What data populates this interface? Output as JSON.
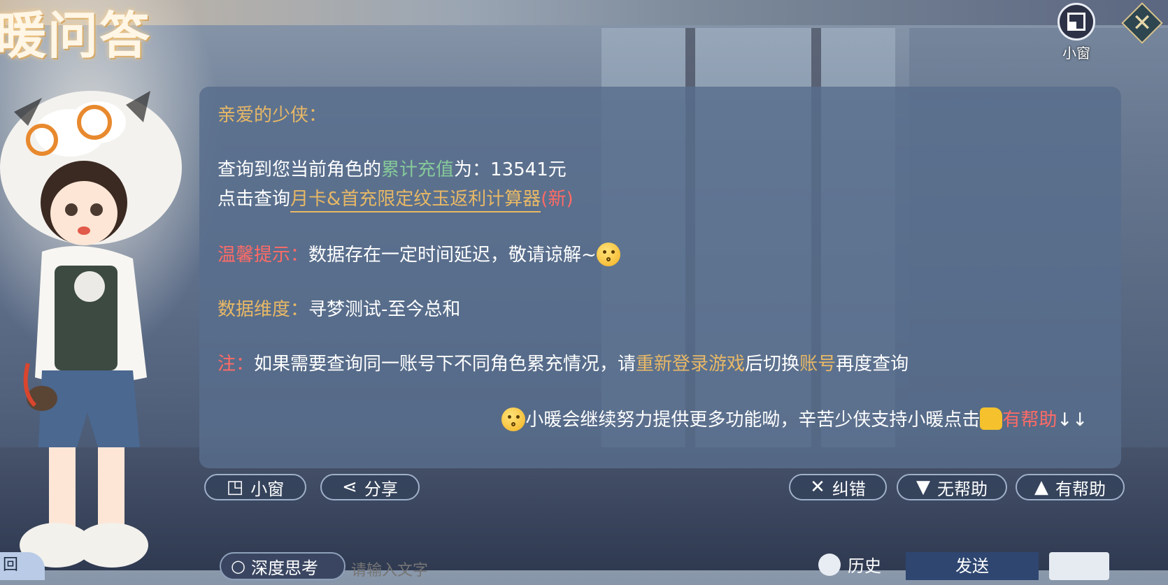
{
  "title": "暖问答",
  "top_controls": {
    "mini_window_label": "小窗"
  },
  "panel": {
    "greeting": "亲爱的少侠：",
    "recharge_prefix": "查询到您当前角色的",
    "recharge_highlight": "累计充值",
    "recharge_suffix": "为：13541元",
    "query_prefix": "点击查询",
    "query_link": "月卡&首充限定纹玉返利计算器",
    "query_new": "(新)",
    "tip_label": "温馨提示：",
    "tip_text": "数据存在一定时间延迟，敬请谅解~",
    "dimension_label": "数据维度：",
    "dimension_value": "寻梦测试-至今总和",
    "note_label": "注：",
    "note_text_1": "如果需要查询同一账号下不同角色累充情况，请",
    "note_highlight_1": "重新登录游戏",
    "note_text_2": "后切换",
    "note_highlight_2": "账号",
    "note_text_3": "再度查询",
    "footer_text": "小暖会继续努力提供更多功能呦，辛苦少侠支持小暖点击",
    "footer_helpful": "有帮助",
    "footer_arrows": "↓↓"
  },
  "actions": {
    "mini_window": "小窗",
    "share": "分享",
    "correct": "纠错",
    "not_helpful": "无帮助",
    "helpful": "有帮助"
  },
  "bottom_bar": {
    "deep_think": "深度思考",
    "input_placeholder": "请输入文字",
    "history": "历史",
    "send": "发送",
    "corner": "回"
  },
  "colors": {
    "gold": "#e8b866",
    "green": "#86c99a",
    "red": "#ff6b66",
    "panel_bg": "#586e8c"
  }
}
